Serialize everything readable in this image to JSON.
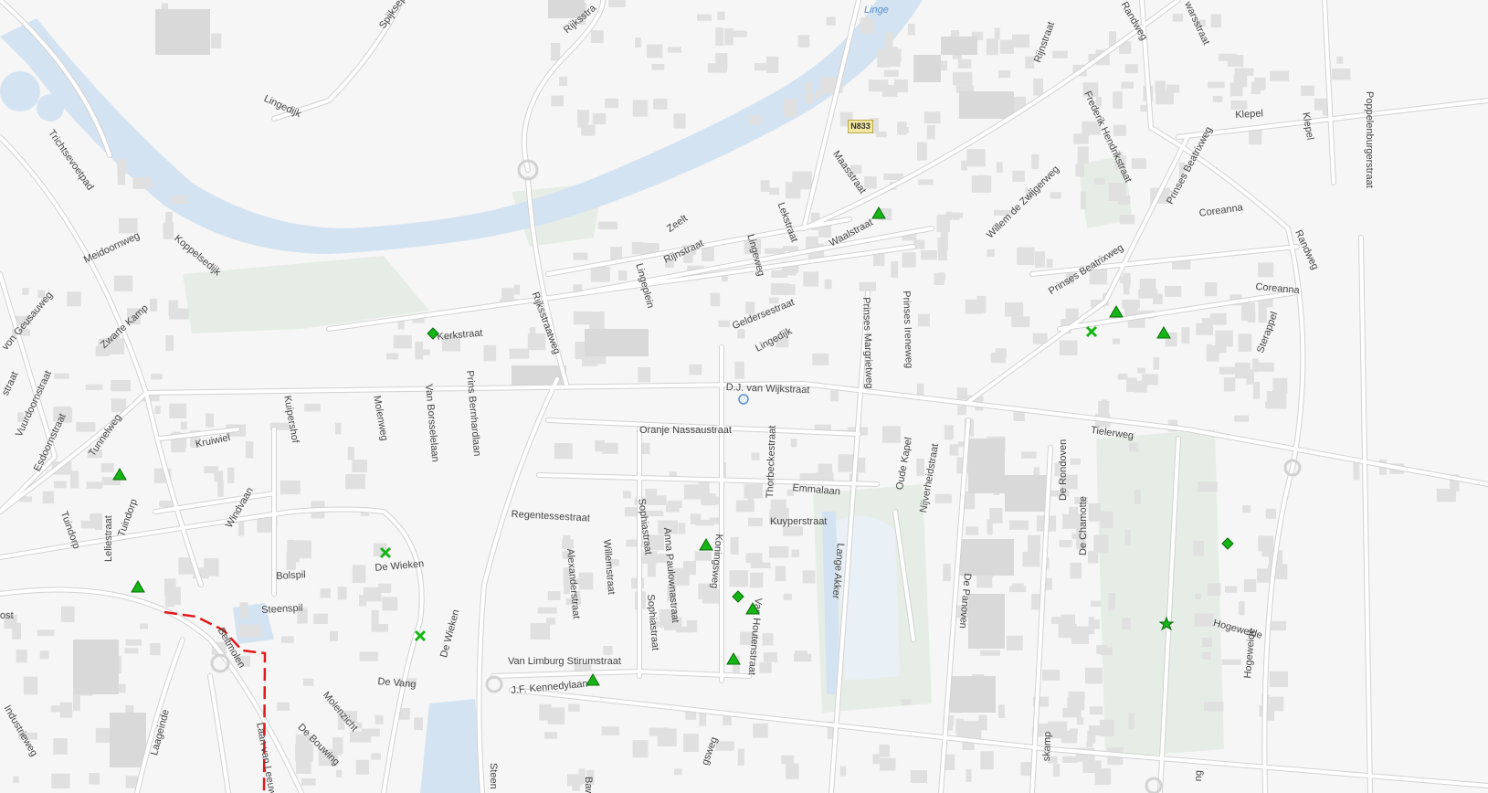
{
  "map": {
    "colors": {
      "background": "#f6f6f6",
      "road": "#ffffff",
      "road_casing": "#d2d2d2",
      "building": "#e0e0e0",
      "water": "#d4e3f1",
      "green": "#e6ede6",
      "marker_fill": "#16b516",
      "marker_outline": "#0a6b0a",
      "route": "#e0191b"
    },
    "road_shield": "N833",
    "water_label": "Linge",
    "street_labels": [
      {
        "id": "spijksepad",
        "text": "Spijksepa"
      },
      {
        "id": "rijksstraatweg-top",
        "text": "Rijksstra"
      },
      {
        "id": "lingedijk-w",
        "text": "Lingedijk"
      },
      {
        "id": "trichtsevoetpad",
        "text": "Trichtsevoetpad"
      },
      {
        "id": "koppelsedijk",
        "text": "Koppelsedijk"
      },
      {
        "id": "meidoornweg",
        "text": "Meidoornweg"
      },
      {
        "id": "von-geusaulweg",
        "text": "von Geusauweg"
      },
      {
        "id": "zwarte-kamp",
        "text": "Zwarte Kamp"
      },
      {
        "id": "straat-w",
        "text": "straat"
      },
      {
        "id": "vuurdoornstraat",
        "text": "Vuurdoornstraat"
      },
      {
        "id": "esdoornstraat",
        "text": "Esdoornstraat"
      },
      {
        "id": "tunnelweg",
        "text": "Tunnelweg"
      },
      {
        "id": "kruiwiel",
        "text": "Kruiwiel"
      },
      {
        "id": "kuipershof",
        "text": "Kuipershof"
      },
      {
        "id": "molenweg",
        "text": "Molenweg"
      },
      {
        "id": "van-borsselelaan",
        "text": "Van Borsselelaan"
      },
      {
        "id": "prins-bernhardlaan",
        "text": "Prins Bernhardlaan"
      },
      {
        "id": "kerkstraat",
        "text": "Kerkstraat"
      },
      {
        "id": "rijksstraatweg",
        "text": "Rijksstraatweg"
      },
      {
        "id": "lingeplein",
        "text": "Lingeplein"
      },
      {
        "id": "zeelt",
        "text": "Zeelt"
      },
      {
        "id": "rijnstraat-mid",
        "text": "Rijnstraat"
      },
      {
        "id": "lingeweg",
        "text": "Lingeweg"
      },
      {
        "id": "lekstraat",
        "text": "Lekstraat"
      },
      {
        "id": "maasstraat",
        "text": "Maasstraat"
      },
      {
        "id": "waalstraat",
        "text": "Waalstraat"
      },
      {
        "id": "geldersestraat",
        "text": "Geldersestraat"
      },
      {
        "id": "lingedijk-mid",
        "text": "Lingedijk"
      },
      {
        "id": "rijnstraat-top",
        "text": "Rijnstraat"
      },
      {
        "id": "randweg-top",
        "text": "Randweg"
      },
      {
        "id": "warsstraat",
        "text": "warsstraat"
      },
      {
        "id": "poppelenburg",
        "text": "Poppelenb"
      },
      {
        "id": "poppelenburgerstraat",
        "text": "Poppelenburgerstraat"
      },
      {
        "id": "klepel-h",
        "text": "Klepel"
      },
      {
        "id": "klepel-v",
        "text": "Klepel"
      },
      {
        "id": "frederik-hendrikstraat",
        "text": "Frederik Hendrikstraat"
      },
      {
        "id": "prinses-beatrixweg-top",
        "text": "Prinses Beatrixweg"
      },
      {
        "id": "willem-de-zwijgerweg",
        "text": "Willem de Zwijgerweg"
      },
      {
        "id": "coreanna-top",
        "text": "Coreanna"
      },
      {
        "id": "prinses-beatrixweg",
        "text": "Prinses Beatrixweg"
      },
      {
        "id": "coreanna",
        "text": "Coreanna"
      },
      {
        "id": "randweg-e",
        "text": "Randweg"
      },
      {
        "id": "sterappel",
        "text": "Sterappel"
      },
      {
        "id": "prinses-margrietweg",
        "text": "Prinses Margrietweg"
      },
      {
        "id": "prinses-ireneweg",
        "text": "Prinses Ireneweg"
      },
      {
        "id": "dj-van-wijkstraat",
        "text": "D.J. van Wijkstraat"
      },
      {
        "id": "tielerweg",
        "text": "Tielerweg"
      },
      {
        "id": "oranje-nassaustraat",
        "text": "Oranje Nassaustraat"
      },
      {
        "id": "oude-kapel",
        "text": "Oude Kapel"
      },
      {
        "id": "nijverheidstraat",
        "text": "Nijverheidstraat"
      },
      {
        "id": "emmalaan",
        "text": "Emmalaan"
      },
      {
        "id": "regentessestraat",
        "text": "Regentessestraat"
      },
      {
        "id": "sophiastraat-top",
        "text": "Sophiastraat"
      },
      {
        "id": "anna-paulownastraat",
        "text": "Anna Paulownastraat"
      },
      {
        "id": "koningsweg",
        "text": "Koningsweg"
      },
      {
        "id": "thorbeckestraat",
        "text": "Thorbeckestraat"
      },
      {
        "id": "kuyperstraat",
        "text": "Kuyperstraat"
      },
      {
        "id": "willemstraat",
        "text": "Willemstraat"
      },
      {
        "id": "alexanderstraat",
        "text": "Alexanderstraat"
      },
      {
        "id": "sophiastraat",
        "text": "Sophiastraat"
      },
      {
        "id": "van-houtenstraat",
        "text": "Van Houtenstraat"
      },
      {
        "id": "lange-akker",
        "text": "Lange Akker"
      },
      {
        "id": "de-panoven",
        "text": "De Panoven"
      },
      {
        "id": "de-rondoven",
        "text": "De Rondoven"
      },
      {
        "id": "de-chamotte",
        "text": "De Chamotte"
      },
      {
        "id": "hogeweide-h",
        "text": "Hogeweide"
      },
      {
        "id": "hogeweide-v",
        "text": "Hogeweide"
      },
      {
        "id": "van-limburg-stirumstraat",
        "text": "Van Limburg Stirumstraat"
      },
      {
        "id": "jf-kennedylaan",
        "text": "J.F. Kennedylaan"
      },
      {
        "id": "windvaan",
        "text": "Windvaan"
      },
      {
        "id": "tuindorp",
        "text": "Tuindorp"
      },
      {
        "id": "tuindorp-2",
        "text": "Tuindorp"
      },
      {
        "id": "leliestraat",
        "text": "Leliestraat"
      },
      {
        "id": "bolspil",
        "text": "Bolspil"
      },
      {
        "id": "de-wieken",
        "text": "De Wieken"
      },
      {
        "id": "steenspil",
        "text": "Steenspil"
      },
      {
        "id": "de-wieken-2",
        "text": "De Wieken"
      },
      {
        "id": "beltmolen",
        "text": "Beltmolen"
      },
      {
        "id": "de-vang",
        "text": "De Vang"
      },
      {
        "id": "molenzicht",
        "text": "Molenzicht"
      },
      {
        "id": "de-bouwing",
        "text": "De Bouwing"
      },
      {
        "id": "laageinde",
        "text": "Laageinde"
      },
      {
        "id": "laan-van-leeuw",
        "text": "Laan van Leeuw"
      },
      {
        "id": "industrieweg",
        "text": "Industrieweg"
      },
      {
        "id": "ost",
        "text": "ost"
      },
      {
        "id": "steen",
        "text": "Steen"
      },
      {
        "id": "baw",
        "text": "Baw"
      },
      {
        "id": "gsweg",
        "text": "gsweg"
      },
      {
        "id": "skamp",
        "text": "skamp"
      },
      {
        "id": "ng",
        "text": "ng"
      }
    ],
    "markers": [
      {
        "id": "m1",
        "icon": "triangle-marker-icon"
      },
      {
        "id": "m2",
        "icon": "triangle-marker-icon"
      },
      {
        "id": "m3",
        "icon": "cross-marker-icon"
      },
      {
        "id": "m4",
        "icon": "triangle-marker-icon"
      },
      {
        "id": "m5",
        "icon": "diamond-marker-icon"
      },
      {
        "id": "m6",
        "icon": "triangle-marker-icon"
      },
      {
        "id": "m7",
        "icon": "triangle-marker-icon"
      },
      {
        "id": "m8",
        "icon": "cross-marker-icon"
      },
      {
        "id": "m9",
        "icon": "cross-marker-icon"
      },
      {
        "id": "m10",
        "icon": "triangle-marker-icon"
      },
      {
        "id": "m11",
        "icon": "diamond-marker-icon"
      },
      {
        "id": "m12",
        "icon": "triangle-marker-icon"
      },
      {
        "id": "m13",
        "icon": "triangle-marker-icon"
      },
      {
        "id": "m14",
        "icon": "triangle-marker-icon"
      },
      {
        "id": "m15",
        "icon": "diamond-marker-icon"
      },
      {
        "id": "m16",
        "icon": "star-marker-icon"
      },
      {
        "id": "m17",
        "icon": "circle-marker-icon"
      }
    ]
  }
}
